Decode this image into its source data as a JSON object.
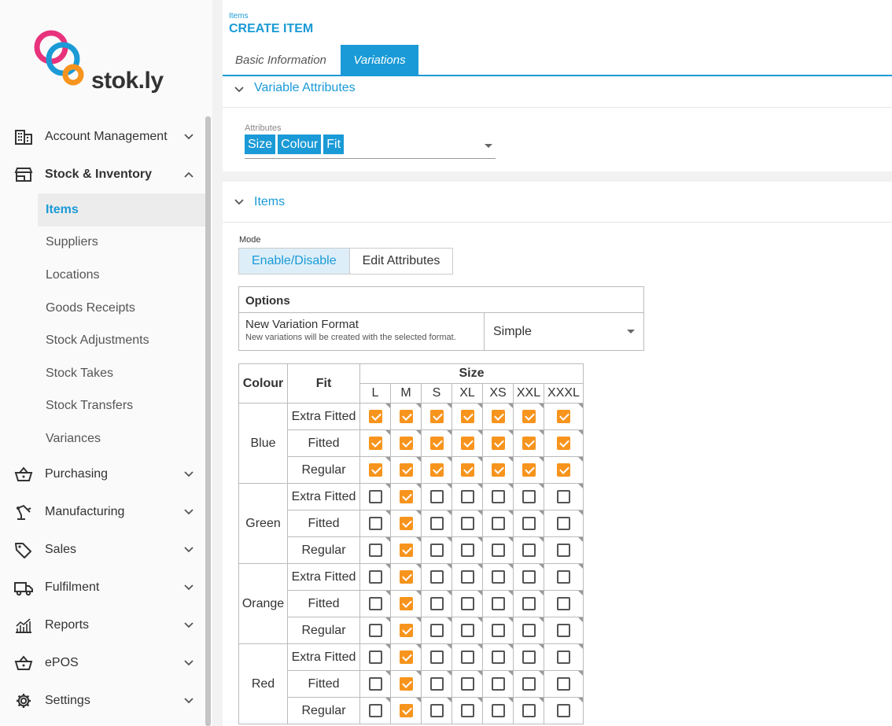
{
  "brand": {
    "name": "stok.ly",
    "colors": {
      "pink": "#e8327c",
      "blue": "#1a9ad6",
      "orange": "#f7941d"
    }
  },
  "sidebar": {
    "items": [
      {
        "label": "Account Management",
        "icon": "building-icon",
        "expanded": false
      },
      {
        "label": "Stock & Inventory",
        "icon": "store-icon",
        "expanded": true,
        "children": [
          "Items",
          "Suppliers",
          "Locations",
          "Goods Receipts",
          "Stock Adjustments",
          "Stock Takes",
          "Stock Transfers",
          "Variances"
        ],
        "active_child": "Items"
      },
      {
        "label": "Purchasing",
        "icon": "basket-icon",
        "expanded": false
      },
      {
        "label": "Manufacturing",
        "icon": "robot-arm-icon",
        "expanded": false
      },
      {
        "label": "Sales",
        "icon": "tag-icon",
        "expanded": false
      },
      {
        "label": "Fulfilment",
        "icon": "truck-icon",
        "expanded": false
      },
      {
        "label": "Reports",
        "icon": "chart-icon",
        "expanded": false
      },
      {
        "label": "ePOS",
        "icon": "basket-icon",
        "expanded": false
      },
      {
        "label": "Settings",
        "icon": "gear-icon",
        "expanded": false
      }
    ]
  },
  "header": {
    "breadcrumb": "Items",
    "title": "CREATE ITEM",
    "tabs": [
      {
        "label": "Basic Information",
        "active": false
      },
      {
        "label": "Variations",
        "active": true
      }
    ]
  },
  "variable_attributes": {
    "section_title": "Variable Attributes",
    "field_label": "Attributes",
    "chips": [
      "Size",
      "Colour",
      "Fit"
    ]
  },
  "items_section": {
    "section_title": "Items",
    "mode_label": "Mode",
    "modes": [
      {
        "label": "Enable/Disable",
        "active": true
      },
      {
        "label": "Edit Attributes",
        "active": false
      }
    ],
    "options": {
      "header": "Options",
      "row_title": "New Variation Format",
      "row_subtitle": "New variations will be created with the selected format.",
      "value": "Simple"
    },
    "grid": {
      "colour_header": "Colour",
      "fit_header": "Fit",
      "size_header": "Size",
      "sizes": [
        "L",
        "M",
        "S",
        "XL",
        "XS",
        "XXL",
        "XXXL"
      ],
      "fits": [
        "Extra Fitted",
        "Fitted",
        "Regular"
      ],
      "rows": [
        {
          "colour": "Blue",
          "checked": [
            [
              1,
              1,
              1,
              1,
              1,
              1,
              1
            ],
            [
              1,
              1,
              1,
              1,
              1,
              1,
              1
            ],
            [
              1,
              1,
              1,
              1,
              1,
              1,
              1
            ]
          ]
        },
        {
          "colour": "Green",
          "checked": [
            [
              0,
              1,
              0,
              0,
              0,
              0,
              0
            ],
            [
              0,
              1,
              0,
              0,
              0,
              0,
              0
            ],
            [
              0,
              1,
              0,
              0,
              0,
              0,
              0
            ]
          ]
        },
        {
          "colour": "Orange",
          "checked": [
            [
              0,
              1,
              0,
              0,
              0,
              0,
              0
            ],
            [
              0,
              1,
              0,
              0,
              0,
              0,
              0
            ],
            [
              0,
              1,
              0,
              0,
              0,
              0,
              0
            ]
          ]
        },
        {
          "colour": "Red",
          "checked": [
            [
              0,
              1,
              0,
              0,
              0,
              0,
              0
            ],
            [
              0,
              1,
              0,
              0,
              0,
              0,
              0
            ],
            [
              0,
              1,
              0,
              0,
              0,
              0,
              0
            ]
          ]
        }
      ]
    }
  }
}
